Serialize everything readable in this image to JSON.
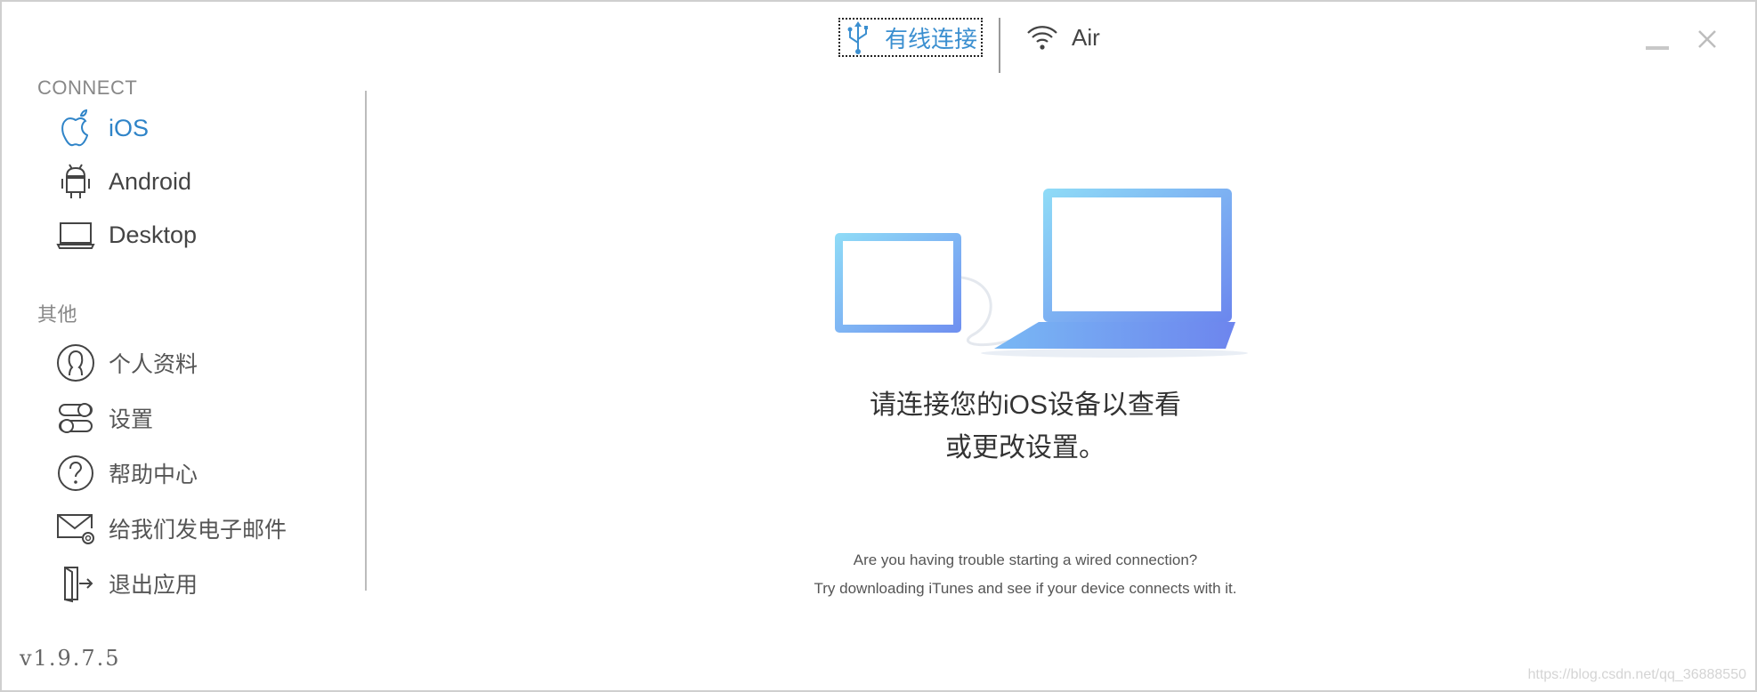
{
  "topbar": {
    "wired_label": "有线连接",
    "air_label": "Air"
  },
  "sidebar": {
    "connect_title": "CONNECT",
    "connect_items": [
      {
        "label": "iOS",
        "icon": "apple-icon"
      },
      {
        "label": "Android",
        "icon": "android-icon"
      },
      {
        "label": "Desktop",
        "icon": "laptop-icon"
      }
    ],
    "other_title": "其他",
    "other_items": [
      {
        "label": "个人资料",
        "icon": "user-profile-icon"
      },
      {
        "label": "设置",
        "icon": "settings-toggle-icon"
      },
      {
        "label": "帮助中心",
        "icon": "help-icon"
      },
      {
        "label": "给我们发电子邮件",
        "icon": "email-icon"
      },
      {
        "label": "退出应用",
        "icon": "exit-icon"
      }
    ],
    "version": "v1.9.7.5"
  },
  "main": {
    "message_line1": "请连接您的iOS设备以查看",
    "message_line2": "或更改设置。",
    "hint_line1": "Are you having trouble starting a wired connection?",
    "hint_line2": "Try downloading iTunes and see if your device connects with it."
  },
  "watermark": "https://blog.csdn.net/qq_36888550",
  "colors": {
    "accent": "#3b8fd0",
    "text": "#444444",
    "muted": "#888888",
    "divider": "#bcbcbc"
  }
}
